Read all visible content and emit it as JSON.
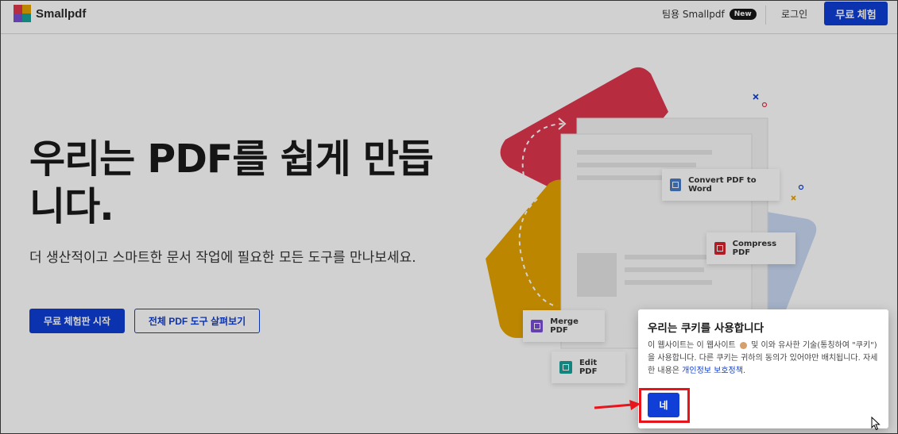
{
  "header": {
    "brand": "Smallpdf",
    "team_label": "팀용 Smallpdf",
    "new_badge": "New",
    "login_label": "로그인",
    "trial_label": "무료 체험"
  },
  "hero": {
    "title": "우리는 PDF를 쉽게 만듭니다.",
    "subtitle": "더 생산적이고 스마트한 문서 작업에 필요한 모든 도구를 만나보세요.",
    "primary_button": "무료 체험판 시작",
    "secondary_button": "전체 PDF 도구 살펴보기"
  },
  "tools": [
    {
      "label": "Convert PDF to Word",
      "icon": "word-convert-icon",
      "color": "#4a7cc8"
    },
    {
      "label": "Compress PDF",
      "icon": "compress-icon",
      "color": "#d8242e"
    },
    {
      "label": "Merge PDF",
      "icon": "merge-icon",
      "color": "#7a4fd6"
    },
    {
      "label": "Edit PDF",
      "icon": "edit-icon",
      "color": "#18a39a"
    }
  ],
  "cookie": {
    "title": "우리는 쿠키를 사용합니다",
    "text_part1": "이 웹사이트는 이 웹사이트",
    "text_part2": "및 이와 유사한 기술(통칭하여 \"쿠키\")을 사용합니다. 다른 쿠키는 귀하의 동의가 있어야만 배치됩니다. 자세한 내용은",
    "link_label": "개인정보 보호정책",
    "text_end": ".",
    "accept_label": "네"
  },
  "colors": {
    "brand_blue": "#0f3fd6",
    "highlight_red": "#e8141b",
    "shape_red": "#e0364e",
    "shape_yellow": "#e6a400",
    "shape_blue": "#c9d8f3"
  }
}
